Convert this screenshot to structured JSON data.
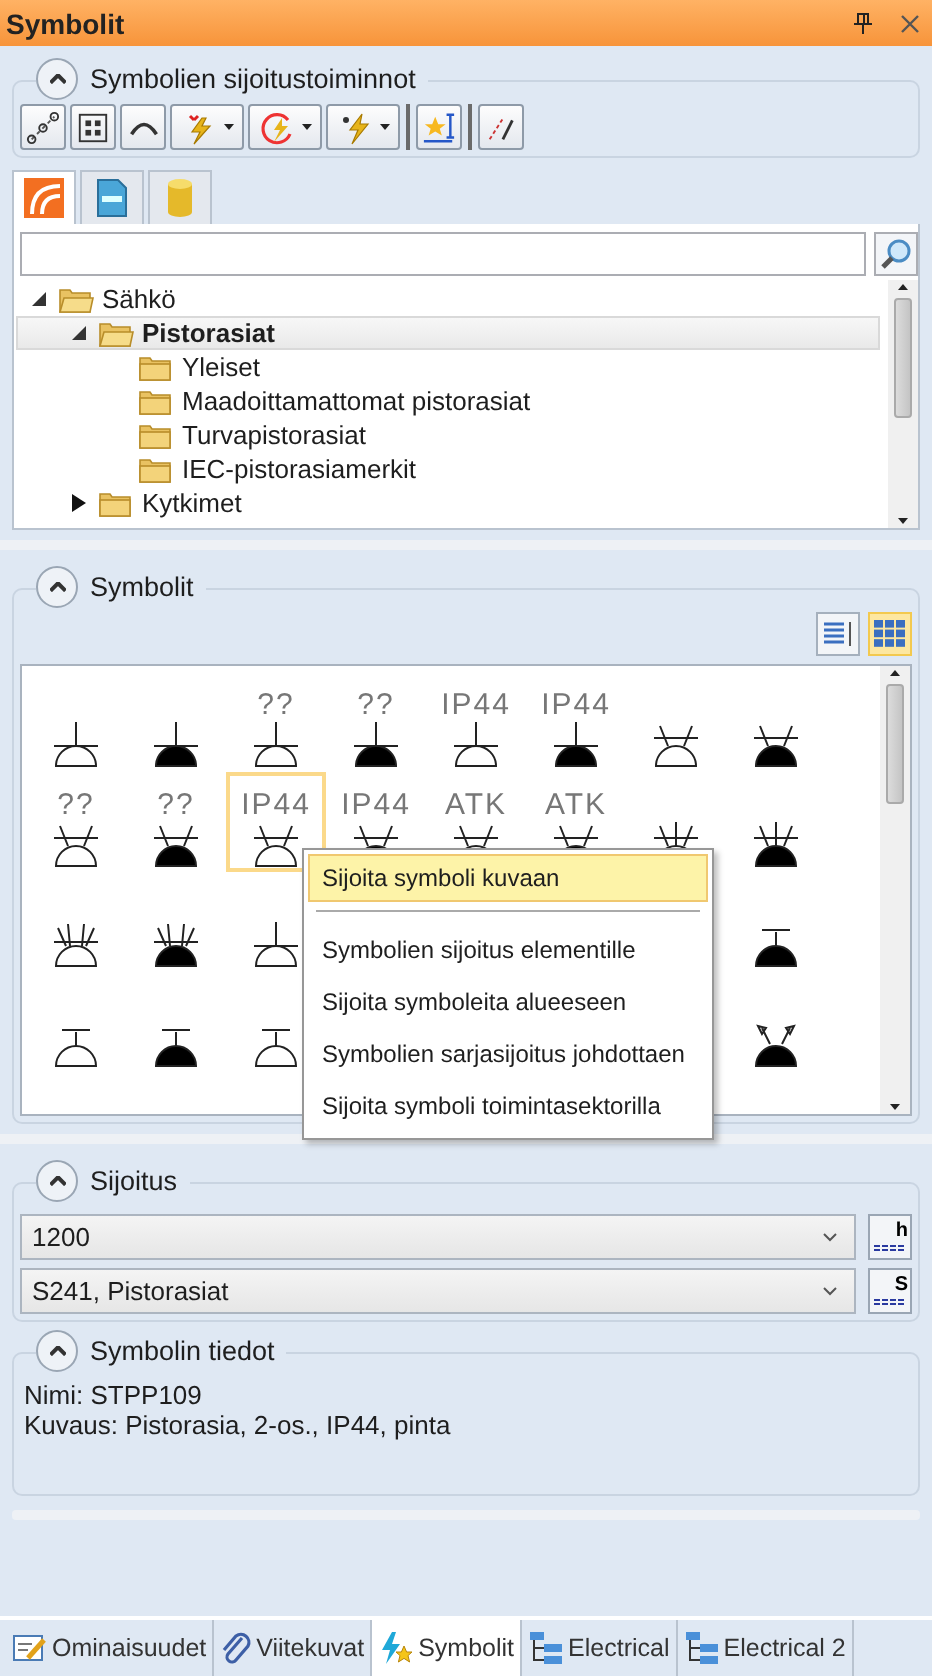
{
  "window": {
    "title": "Symbolit"
  },
  "placement_tools": {
    "title": "Symbolien sijoitustoiminnot",
    "expanded": true,
    "tools": [
      {
        "kind": "dots",
        "has_menu": false
      },
      {
        "kind": "frame",
        "has_menu": false
      },
      {
        "kind": "arc",
        "has_menu": false
      },
      {
        "kind": "bolt",
        "has_menu": true
      },
      {
        "kind": "rotate",
        "has_menu": true
      },
      {
        "kind": "bolt2",
        "has_menu": true
      },
      {
        "kind": "star",
        "has_menu": false
      },
      {
        "kind": "measure",
        "has_menu": false
      }
    ],
    "library_tabs": [
      {
        "kind": "logo",
        "selected": true
      },
      {
        "kind": "doc",
        "selected": false
      },
      {
        "kind": "db",
        "selected": false
      }
    ],
    "tree": [
      {
        "label": "Sähkö",
        "expanded": true,
        "selected": false,
        "children": [
          {
            "label": "Pistorasiat",
            "expanded": true,
            "selected": true,
            "children": [
              {
                "label": "Yleiset",
                "selected": false
              },
              {
                "label": "Maadoittamattomat pistorasiat",
                "selected": false
              },
              {
                "label": "Turvapistorasiat",
                "selected": false
              },
              {
                "label": "IEC-pistorasiamerkit",
                "selected": false
              }
            ]
          },
          {
            "label": "Kytkimet",
            "expanded": false,
            "selected": false
          }
        ]
      }
    ]
  },
  "symbols": {
    "title": "Symbolit",
    "expanded": true,
    "views": [
      {
        "kind": "list",
        "selected": false
      },
      {
        "kind": "grid",
        "selected": true
      }
    ],
    "cells": [
      {
        "kind": "stem",
        "filled": false,
        "selected": false
      },
      {
        "kind": "stem",
        "filled": true,
        "selected": false
      },
      {
        "kind": "stem",
        "filled": false,
        "label": "??",
        "selected": false
      },
      {
        "kind": "stem",
        "filled": true,
        "label": "??",
        "selected": false
      },
      {
        "kind": "stem",
        "filled": false,
        "label": "IP44",
        "selected": false
      },
      {
        "kind": "stem",
        "filled": true,
        "label": "IP44",
        "selected": false
      },
      {
        "kind": "legs",
        "filled": false,
        "selected": false
      },
      {
        "kind": "legs",
        "filled": true,
        "selected": false
      },
      {
        "kind": "legs",
        "filled": false,
        "label": "??",
        "selected": false
      },
      {
        "kind": "legs",
        "filled": true,
        "label": "??",
        "selected": false
      },
      {
        "kind": "legs",
        "filled": false,
        "label": "IP44",
        "selected": true
      },
      {
        "kind": "legs",
        "filled": true,
        "label": "IP44",
        "selected": false
      },
      {
        "kind": "legs",
        "filled": false,
        "label": "ATK",
        "selected": false
      },
      {
        "kind": "legs",
        "filled": true,
        "label": "ATK",
        "selected": false
      },
      {
        "kind": "trident",
        "filled": false,
        "selected": false
      },
      {
        "kind": "trident",
        "filled": true,
        "selected": false
      },
      {
        "kind": "rays",
        "filled": false,
        "selected": false
      },
      {
        "kind": "rays",
        "filled": true,
        "selected": false
      },
      {
        "kind": "stem",
        "filled": false,
        "selected": false
      },
      {
        "kind": "hidden"
      },
      {
        "kind": "hidden"
      },
      {
        "kind": "hidden"
      },
      {
        "kind": "hidden"
      },
      {
        "kind": "tee",
        "filled": true,
        "selected": false
      },
      {
        "kind": "tee",
        "filled": false,
        "selected": false
      },
      {
        "kind": "tee",
        "filled": true,
        "selected": false
      },
      {
        "kind": "tee",
        "filled": false,
        "selected": false
      },
      {
        "kind": "hidden"
      },
      {
        "kind": "hidden"
      },
      {
        "kind": "hidden"
      },
      {
        "kind": "hidden"
      },
      {
        "kind": "arrows",
        "filled": true,
        "selected": false
      }
    ],
    "context_menu": [
      {
        "label": "Sijoita symboli kuvaan",
        "selected": true,
        "separator_after": true
      },
      {
        "label": "Symbolien sijoitus elementille",
        "selected": false,
        "separator_after": false
      },
      {
        "label": "Sijoita symboleita alueeseen",
        "selected": false,
        "separator_after": false
      },
      {
        "label": "Symbolien sarjasijoitus johdottaen",
        "selected": false,
        "separator_after": false
      },
      {
        "label": "Sijoita symboli toimintasektorilla",
        "selected": false,
        "separator_after": false
      }
    ]
  },
  "placement": {
    "title": "Sijoitus",
    "expanded": true,
    "fields": [
      {
        "value": "1200",
        "button": "h"
      },
      {
        "value": "S241, Pistorasiat",
        "button": "S"
      }
    ]
  },
  "symbol_info": {
    "title": "Symbolin tiedot",
    "expanded": true,
    "lines": [
      {
        "label": "Nimi:",
        "value": "STPP109"
      },
      {
        "label": "Kuvaus:",
        "value": "Pistorasia, 2-os., IP44, pinta"
      }
    ]
  },
  "bottom_tabs": [
    {
      "label": "Ominaisuudet",
      "kind": "props",
      "selected": false
    },
    {
      "label": "Viitekuvat",
      "kind": "clip",
      "selected": false
    },
    {
      "label": "Symbolit",
      "kind": "bolt",
      "selected": true
    },
    {
      "label": "Electrical",
      "kind": "tree",
      "selected": false
    },
    {
      "label": "Electrical 2",
      "kind": "tree",
      "selected": false
    }
  ]
}
